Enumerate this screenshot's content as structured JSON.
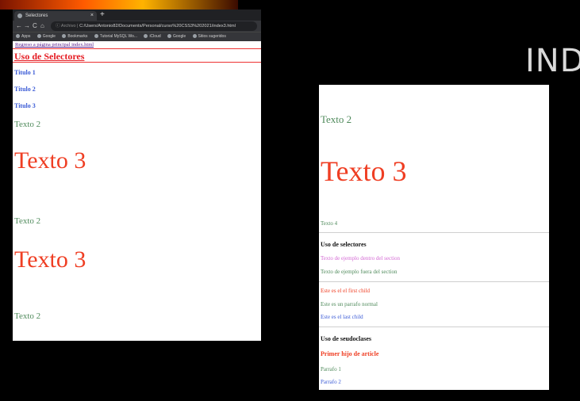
{
  "slide": {
    "title": "IND"
  },
  "browser": {
    "tab_title": "Selectores",
    "tab_close": "×",
    "new_tab": "+",
    "nav": {
      "back": "←",
      "forward": "→",
      "reload": "C",
      "home": "⌂"
    },
    "url_prefix": "ⓘ Archivo |",
    "url": "C:/Users/Antonio82/Documents/Personal/curso%20CSS3%202021/index3.html",
    "bookmarks": [
      "Apps",
      "Google",
      "Bookmarks",
      "Tutorial MySQL Wo...",
      "iCloud",
      "Google",
      "Sitios sugeridos"
    ]
  },
  "page": {
    "back_link": "Regreso a página principal index.html",
    "heading": "Uso de Selectores",
    "titles": [
      "Titulo 1",
      "Titulo 2",
      "Titulo 3"
    ],
    "texto2": "Texto 2",
    "texto3": "Texto 3"
  },
  "doc": {
    "texto2": "Texto 2",
    "texto3": "Texto 3",
    "texto4": "Texto 4",
    "sec1_title": "Uso de selectores",
    "sec1_in": "Texto de ejemplo dentro del section",
    "sec1_out": "Texto de ejemplo fuera del section",
    "first_child": "Este es el el first child",
    "normal": "Este es un parrafo normal",
    "last_child": "Este es el last child",
    "sec2_title": "Uso de seudoclases",
    "first_article": "Primer hijo de article",
    "p1": "Parrafo 1",
    "p2": "Parrafo 2"
  },
  "colors": {
    "red": "#ef3e23",
    "green": "#4f8a5b",
    "blue": "#3b5bd6",
    "pink": "#d46ad4",
    "link": "#551a8b"
  }
}
